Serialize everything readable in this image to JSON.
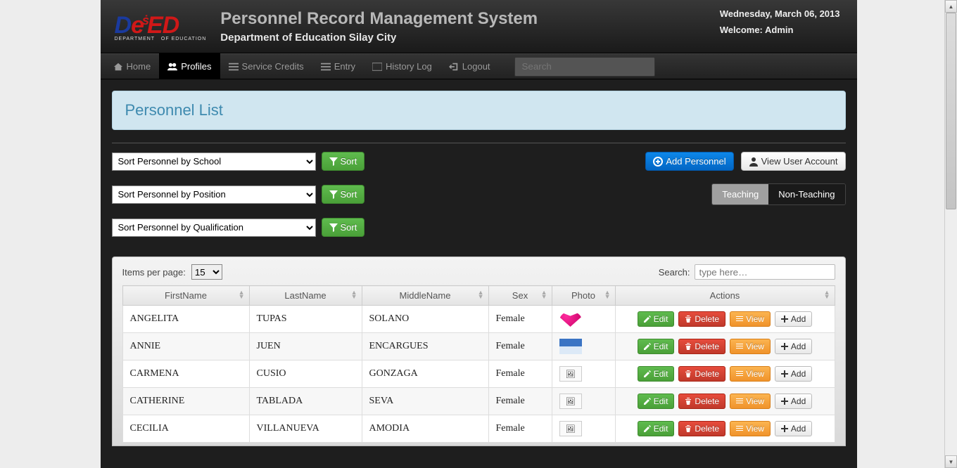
{
  "header": {
    "system_title": "Personnel Record Management System",
    "system_subtitle": "Department of Education Silay City",
    "logo_alt": "DepED - Department of Education",
    "date": "Wednesday, March 06, 2013",
    "welcome": "Welcome: Admin"
  },
  "nav": {
    "home": "Home",
    "profiles": "Profiles",
    "service_credits": "Service Credits",
    "entry": "Entry",
    "history_log": "History Log",
    "logout": "Logout",
    "search_placeholder": "Search"
  },
  "page": {
    "title": "Personnel List",
    "sort_school": "Sort Personnel by School",
    "sort_position": "Sort Personnel by Position",
    "sort_qualification": "Sort Personnel by Qualification",
    "sort_btn": "Sort",
    "add_personnel": "Add Personnel",
    "view_user_account": "View User Account",
    "tab_teaching": "Teaching",
    "tab_nonteaching": "Non-Teaching"
  },
  "table": {
    "items_per_page_label": "Items per page:",
    "items_per_page_value": "15",
    "search_label": "Search:",
    "search_placeholder": "type here…",
    "cols": {
      "first": "FirstName",
      "last": "LastName",
      "middle": "MiddleName",
      "sex": "Sex",
      "photo": "Photo",
      "actions": "Actions"
    },
    "rows": [
      {
        "first": "ANGELITA",
        "last": "TUPAS",
        "middle": "SOLANO",
        "sex": "Female",
        "photo": "heart"
      },
      {
        "first": "ANNIE",
        "last": "JUEN",
        "middle": "ENCARGUES",
        "sex": "Female",
        "photo": "mountain"
      },
      {
        "first": "CARMENA",
        "last": "CUSIO",
        "middle": "GONZAGA",
        "sex": "Female",
        "photo": "placeholder"
      },
      {
        "first": "CATHERINE",
        "last": "TABLADA",
        "middle": "SEVA",
        "sex": "Female",
        "photo": "placeholder"
      },
      {
        "first": "CECILIA",
        "last": "VILLANUEVA",
        "middle": "AMODIA",
        "sex": "Female",
        "photo": "placeholder"
      }
    ],
    "actions": {
      "edit": "Edit",
      "delete": "Delete",
      "view": "View",
      "add": "Add"
    }
  }
}
